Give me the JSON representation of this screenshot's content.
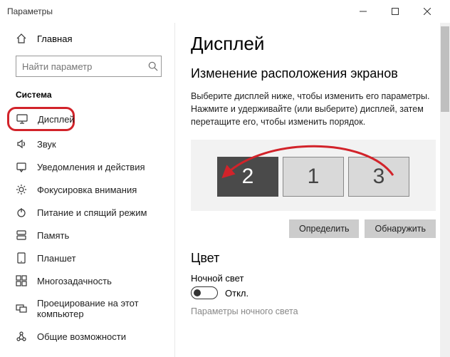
{
  "window": {
    "title": "Параметры"
  },
  "home_label": "Главная",
  "search": {
    "placeholder": "Найти параметр"
  },
  "section_label": "Система",
  "nav": [
    {
      "icon": "display",
      "label": "Дисплей",
      "active": true
    },
    {
      "icon": "sound",
      "label": "Звук"
    },
    {
      "icon": "notif",
      "label": "Уведомления и действия"
    },
    {
      "icon": "focus",
      "label": "Фокусировка внимания"
    },
    {
      "icon": "power",
      "label": "Питание и спящий режим"
    },
    {
      "icon": "storage",
      "label": "Память"
    },
    {
      "icon": "tablet",
      "label": "Планшет"
    },
    {
      "icon": "multi",
      "label": "Многозадачность"
    },
    {
      "icon": "project",
      "label": "Проецирование на этот компьютер"
    },
    {
      "icon": "shared",
      "label": "Общие возможности"
    }
  ],
  "content": {
    "title": "Дисплей",
    "arrange_heading": "Изменение расположения экранов",
    "arrange_desc": "Выберите дисплей ниже, чтобы изменить его параметры. Нажмите и удерживайте (или выберите) дисплей, затем перетащите его, чтобы изменить порядок.",
    "monitors": [
      "2",
      "1",
      "3"
    ],
    "btn_identify": "Определить",
    "btn_detect": "Обнаружить",
    "color_heading": "Цвет",
    "night_label": "Ночной свет",
    "toggle_state": "Откл.",
    "night_settings": "Параметры ночного света"
  }
}
